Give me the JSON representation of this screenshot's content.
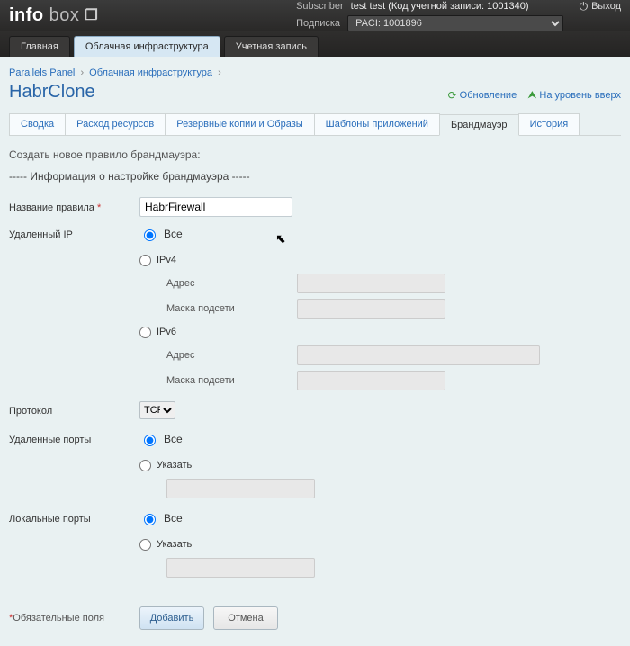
{
  "header": {
    "brand_prefix": "info",
    "brand_suffix": "box",
    "subscriber_label": "Subscriber",
    "subscriber_value": "test test (Код учетной записи: 1001340)",
    "subscription_label": "Подписка",
    "subscription_value": "PACI: 1001896",
    "logout_label": "Выход"
  },
  "nav": {
    "items": [
      "Главная",
      "Облачная инфраструктура",
      "Учетная запись"
    ],
    "active_index": 1
  },
  "breadcrumb": {
    "items": [
      "Parallels Panel",
      "Облачная инфраструктура"
    ]
  },
  "page": {
    "title": "HabrClone",
    "actions": {
      "refresh": "Обновление",
      "up": "На уровень вверх"
    },
    "subtabs": [
      "Сводка",
      "Расход ресурсов",
      "Резервные копии и Образы",
      "Шаблоны приложений",
      "Брандмауэр",
      "История"
    ],
    "subtab_active_index": 4
  },
  "form": {
    "create_note": "Создать новое правило брандмауэра:",
    "section_head": "----- Информация о настройке брандмауэра -----",
    "rule_name_label": "Название правила",
    "rule_name_value": "HabrFirewall",
    "remote_ip_label": "Удаленный IP",
    "radio_all": "Все",
    "radio_ipv4": "IPv4",
    "radio_ipv6": "IPv6",
    "addr_label": "Адрес",
    "mask_label": "Маска подсети",
    "protocol_label": "Протокол",
    "protocol_value": "TCP",
    "remote_ports_label": "Удаленные порты",
    "local_ports_label": "Локальные порты",
    "radio_specify": "Указать",
    "req_note": "*Обязательные поля",
    "btn_add": "Добавить",
    "btn_cancel": "Отмена"
  }
}
